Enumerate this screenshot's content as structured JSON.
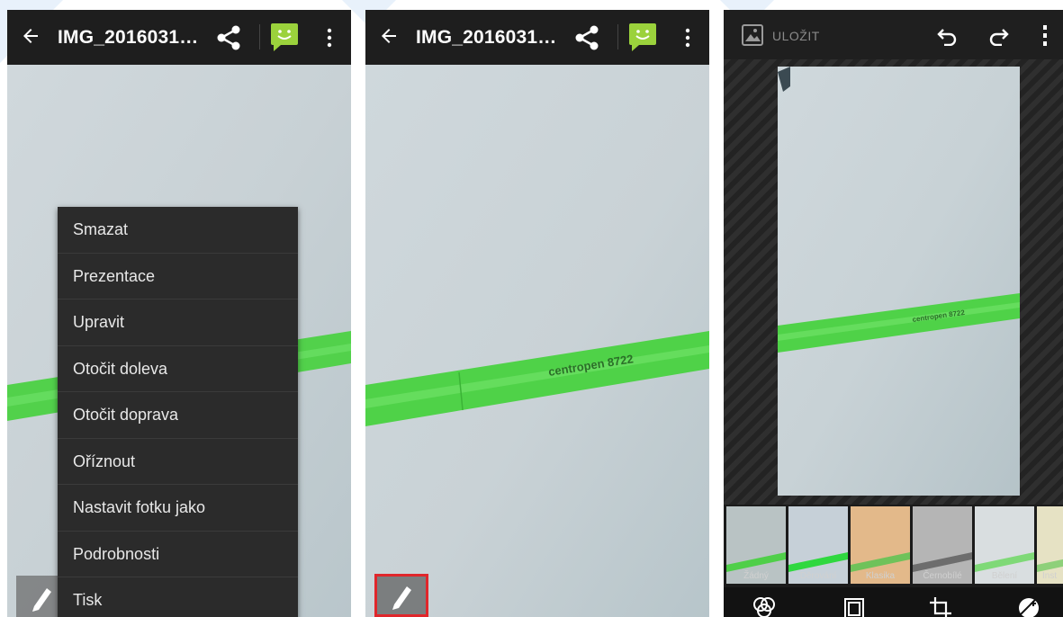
{
  "screens": {
    "menu_screen": {
      "title": "IMG_2016031…",
      "menu_items": [
        "Smazat",
        "Prezentace",
        "Upravit",
        "Otočit doleva",
        "Otočit doprava",
        "Oříznout",
        "Nastavit fotku jako",
        "Podrobnosti",
        "Tisk"
      ]
    },
    "viewer_screen": {
      "title": "IMG_2016031…",
      "edit_button_highlighted": true
    },
    "editor_screen": {
      "save_label": "ULOŽIT",
      "filters": [
        {
          "label": "Žádný",
          "selected": true,
          "tint": "#b9c3c4"
        },
        {
          "label": "Děrování",
          "selected": false,
          "tint": "#c6d0d8"
        },
        {
          "label": "Klasika",
          "selected": false,
          "tint": "#e3b98a"
        },
        {
          "label": "Černobílé",
          "selected": false,
          "tint": "#b5b5b5"
        },
        {
          "label": "Bělení",
          "selected": false,
          "tint": "#d9dee0"
        },
        {
          "label": "Inst",
          "selected": false,
          "tint": "#e6e2c4"
        }
      ],
      "tools": [
        "filters-icon",
        "frame-icon",
        "crop-icon",
        "adjust-icon"
      ]
    }
  },
  "photo_text": "centropen 8722",
  "colors": {
    "topbar": "#1e1e1e",
    "menu_bg": "#2b2b2b",
    "photo_bg": "#c6cfd3",
    "marker_green": "#4fd44a",
    "highlight": "#e0262b"
  }
}
